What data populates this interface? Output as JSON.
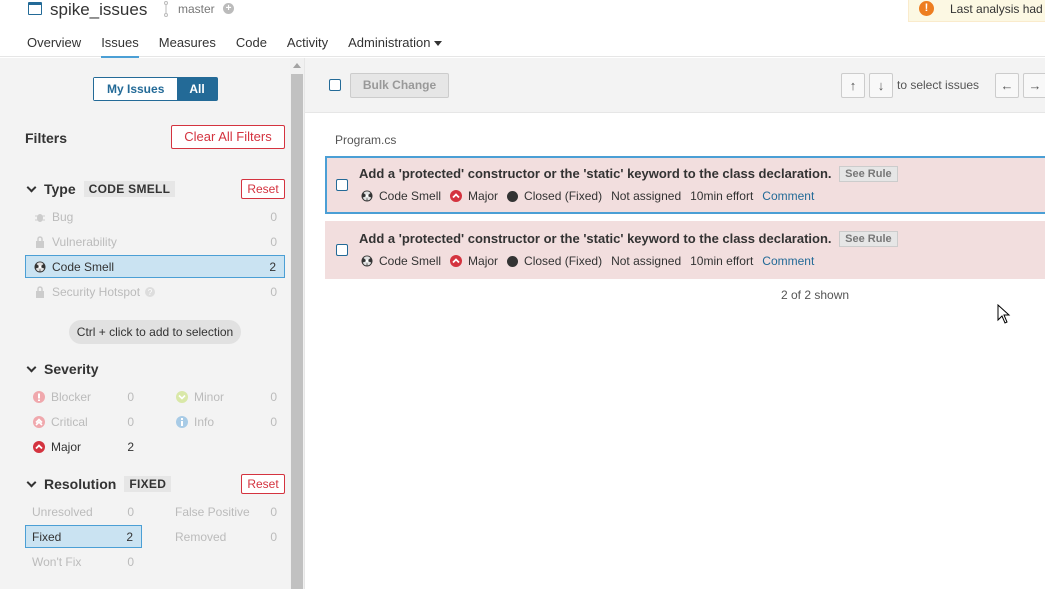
{
  "header": {
    "project_name": "spike_issues",
    "branch": "master",
    "alert_text": "Last analysis had"
  },
  "nav": {
    "items": [
      "Overview",
      "Issues",
      "Measures",
      "Code",
      "Activity",
      "Administration"
    ],
    "active": "Issues"
  },
  "sidebar": {
    "toggle": {
      "my_issues": "My Issues",
      "all": "All"
    },
    "filters_title": "Filters",
    "clear_all": "Clear All Filters",
    "ctrl_hint": "Ctrl + click to add to selection",
    "type_facet": {
      "title": "Type",
      "badge": "CODE SMELL",
      "reset": "Reset",
      "items": [
        {
          "label": "Bug",
          "count": "0",
          "icon": "bug-icon"
        },
        {
          "label": "Vulnerability",
          "count": "0",
          "icon": "lock-icon"
        },
        {
          "label": "Code Smell",
          "count": "2",
          "icon": "code-smell-icon"
        },
        {
          "label": "Security Hotspot",
          "count": "0",
          "icon": "lock-icon"
        }
      ]
    },
    "severity_facet": {
      "title": "Severity",
      "items": [
        {
          "label": "Blocker",
          "count": "0"
        },
        {
          "label": "Minor",
          "count": "0"
        },
        {
          "label": "Critical",
          "count": "0"
        },
        {
          "label": "Info",
          "count": "0"
        },
        {
          "label": "Major",
          "count": "2"
        }
      ]
    },
    "resolution_facet": {
      "title": "Resolution",
      "badge": "FIXED",
      "reset": "Reset",
      "items": [
        {
          "label": "Unresolved",
          "count": "0"
        },
        {
          "label": "False Positive",
          "count": "0"
        },
        {
          "label": "Fixed",
          "count": "2"
        },
        {
          "label": "Removed",
          "count": "0"
        },
        {
          "label": "Won't Fix",
          "count": "0"
        }
      ]
    }
  },
  "toolbar": {
    "bulk_change": "Bulk Change",
    "up": "↑",
    "down": "↓",
    "select_hint": "to select issues",
    "left": "←",
    "right": "→"
  },
  "issues": {
    "file": "Program.cs",
    "list": [
      {
        "message": "Add a 'protected' constructor or the 'static' keyword to the class declaration.",
        "see_rule": "See Rule",
        "type": "Code Smell",
        "severity": "Major",
        "status": "Closed (Fixed)",
        "assignee": "Not assigned",
        "effort": "10min effort",
        "comment": "Comment"
      },
      {
        "message": "Add a 'protected' constructor or the 'static' keyword to the class declaration.",
        "see_rule": "See Rule",
        "type": "Code Smell",
        "severity": "Major",
        "status": "Closed (Fixed)",
        "assignee": "Not assigned",
        "effort": "10min effort",
        "comment": "Comment"
      }
    ],
    "shown": "2 of 2 shown"
  },
  "colors": {
    "accent": "#236a97",
    "issue_bg": "#f2dede",
    "reset_red": "#d4333f",
    "selected_bg": "#cae3f2"
  }
}
